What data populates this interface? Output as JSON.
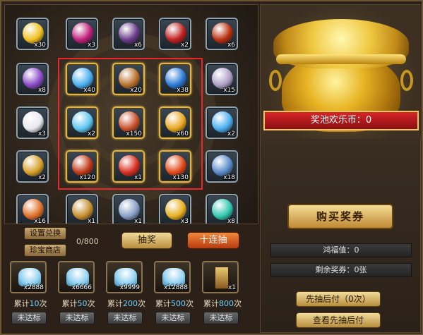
{
  "grid": {
    "slots": [
      {
        "name": "gold-ingot",
        "count": "x30",
        "color": "#f0c020",
        "highlight": false
      },
      {
        "name": "magic-orb",
        "count": "x3",
        "color": "#c0207a",
        "highlight": false
      },
      {
        "name": "treasure-chest",
        "count": "x6",
        "color": "#6a3c8a",
        "highlight": false
      },
      {
        "name": "scroll",
        "count": "x2",
        "color": "#c02020",
        "highlight": false
      },
      {
        "name": "fire-rune",
        "count": "x6",
        "color": "#b83010",
        "highlight": false
      },
      {
        "name": "purple-gem",
        "count": "x8",
        "color": "#8a4ac8",
        "highlight": false
      },
      {
        "name": "blue-crescent",
        "count": "x40",
        "color": "#4ab0f0",
        "highlight": true
      },
      {
        "name": "bronze-chest",
        "count": "x20",
        "color": "#b8702a",
        "highlight": true
      },
      {
        "name": "blue-crystals",
        "count": "x38",
        "color": "#2a7ad8",
        "highlight": true
      },
      {
        "name": "silver-shards",
        "count": "x15",
        "color": "#b0a0c8",
        "highlight": false
      },
      {
        "name": "white-egg",
        "count": "x3",
        "color": "#e8e8f0",
        "highlight": false
      },
      {
        "name": "blue-shard",
        "count": "x2",
        "color": "#60c8f0",
        "highlight": true
      },
      {
        "name": "phoenix-card",
        "count": "x150",
        "color": "#c8502a",
        "highlight": true
      },
      {
        "name": "gold-note-card",
        "count": "x60",
        "color": "#e8a820",
        "highlight": true
      },
      {
        "name": "blue-crescent-small",
        "count": "x2",
        "color": "#4ab0f0",
        "highlight": false
      },
      {
        "name": "gold-sword-card",
        "count": "x2",
        "color": "#d8a02a",
        "highlight": false
      },
      {
        "name": "red-armor",
        "count": "x120",
        "color": "#c03818",
        "highlight": true
      },
      {
        "name": "gift-box",
        "count": "x1",
        "color": "#d83020",
        "highlight": true
      },
      {
        "name": "fire-emblem",
        "count": "x130",
        "color": "#e04818",
        "highlight": true
      },
      {
        "name": "blue-silver-chest",
        "count": "x18",
        "color": "#5a8ac8",
        "highlight": false
      },
      {
        "name": "orange-box",
        "count": "x16",
        "color": "#e0702a",
        "highlight": false
      },
      {
        "name": "golden-chest",
        "count": "x1",
        "color": "#c89030",
        "highlight": false
      },
      {
        "name": "silver-ingot",
        "count": "x1",
        "color": "#8aa0c8",
        "highlight": false
      },
      {
        "name": "music-card",
        "count": "x3",
        "color": "#e8b020",
        "highlight": false
      },
      {
        "name": "teal-gem",
        "count": "x8",
        "color": "#30c8b0",
        "highlight": false
      }
    ]
  },
  "controls": {
    "settings_exchange": "设置兑换",
    "treasure_shop": "珍宝商店",
    "progress": "0/800",
    "draw_one": "抽奖",
    "draw_ten": "十连抽"
  },
  "rewards": [
    {
      "count": "x2888",
      "prefix": "累计",
      "num": "10",
      "suffix": "次",
      "status": "未达标",
      "kind": "pile"
    },
    {
      "count": "x6666",
      "prefix": "累计",
      "num": "50",
      "suffix": "次",
      "status": "未达标",
      "kind": "pile"
    },
    {
      "count": "x9999",
      "prefix": "累计",
      "num": "200",
      "suffix": "次",
      "status": "未达标",
      "kind": "pile"
    },
    {
      "count": "x12888",
      "prefix": "累计",
      "num": "500",
      "suffix": "次",
      "status": "未达标",
      "kind": "pile"
    },
    {
      "count": "x1",
      "prefix": "累计",
      "num": "800",
      "suffix": "次",
      "status": "未达标",
      "kind": "card"
    }
  ],
  "right": {
    "banner": "奖池欢乐币：0",
    "buy": "购买奖券",
    "luck": "鸿福值：0",
    "tickets": "剩余奖券：0张",
    "draw_then_pay": "先抽后付（0次）",
    "view_draw_then_pay": "查看先抽后付"
  },
  "colors": {
    "highlight_border": "#e8262c",
    "gold_border": "#e0b84a",
    "reward_number": "#6fd0ff"
  }
}
